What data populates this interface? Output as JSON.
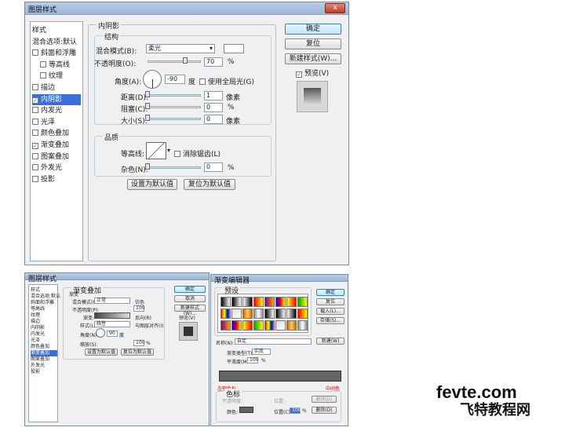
{
  "top": {
    "title": "图层样式",
    "close": "x",
    "sidebar": {
      "items": [
        {
          "label": "样式",
          "check": false,
          "kind": "plain"
        },
        {
          "label": "混合选项:默认",
          "check": false,
          "kind": "plain"
        },
        {
          "label": "斜面和浮雕",
          "check": false,
          "kind": "cb"
        },
        {
          "label": "等高线",
          "check": false,
          "kind": "sub"
        },
        {
          "label": "纹理",
          "check": false,
          "kind": "sub"
        },
        {
          "label": "描边",
          "check": false,
          "kind": "cb"
        },
        {
          "label": "内阴影",
          "check": true,
          "kind": "sel"
        },
        {
          "label": "内发光",
          "check": false,
          "kind": "cb"
        },
        {
          "label": "光泽",
          "check": false,
          "kind": "cb"
        },
        {
          "label": "颜色叠加",
          "check": false,
          "kind": "cb"
        },
        {
          "label": "渐变叠加",
          "check": true,
          "kind": "cb"
        },
        {
          "label": "图案叠加",
          "check": false,
          "kind": "cb"
        },
        {
          "label": "外发光",
          "check": false,
          "kind": "cb"
        },
        {
          "label": "投影",
          "check": false,
          "kind": "cb"
        }
      ]
    },
    "section": "内阴影",
    "struct": "结构",
    "blend_label": "混合模式(B):",
    "blend_value": "柔光",
    "opacity_label": "不透明度(O):",
    "opacity_value": "70",
    "pct": "%",
    "angle_label": "角度(A):",
    "angle_value": "-90",
    "degree": "度",
    "global_light": "使用全局光(G)",
    "distance_label": "距离(D):",
    "distance_value": "1",
    "px": "像素",
    "choke_label": "阻塞(C):",
    "choke_value": "0",
    "size_label": "大小(S):",
    "size_value": "0",
    "quality": "品质",
    "contour_label": "等高线:",
    "antialias": "消除锯齿(L)",
    "noise_label": "杂色(N):",
    "noise_value": "0",
    "set_default": "设置为默认值",
    "reset_default": "复位为默认值",
    "ok": "确定",
    "reset": "复位",
    "new_style": "新建样式(W)...",
    "preview": "预览(V)",
    "opacity_fraction": 0.7
  },
  "bottom_left": {
    "title": "图层样式",
    "section": "渐变叠加",
    "sub": "渐变",
    "blend_label": "混合模式(O):",
    "blend_value": "正常",
    "dither": "仿色",
    "opacity_label": "不透明度(P):",
    "opacity_value": "100",
    "gradient_label": "渐变:",
    "reverse": "反向(R)",
    "style_label": "样式(L):",
    "style_value": "线性",
    "align": "与图层对齐(I)",
    "angle_label": "角度(N):",
    "angle_value": "90",
    "degree": "度",
    "scale_label": "缩放(S):",
    "scale_value": "100",
    "pct": "%",
    "set_default": "设置为默认值",
    "reset_default": "复位为默认值",
    "ok": "确定",
    "cancel": "取消",
    "new_style": "新建样式(W)...",
    "preview": "预览(V)",
    "items": [
      "样式",
      "混合选项:默认",
      "斜面和浮雕",
      "等高线",
      "纹理",
      "描边",
      "内阴影",
      "内发光",
      "光泽",
      "颜色叠加",
      "渐变叠加",
      "图案叠加",
      "外发光",
      "投影"
    ]
  },
  "gradient_editor": {
    "title": "渐变编辑器",
    "presets": "预设",
    "ok": "确定",
    "reset": "复位",
    "load": "载入(L)...",
    "save": "存储(S)...",
    "name_label": "名称(N):",
    "name_value": "自定",
    "new": "新建(W)",
    "type_label": "渐变类型(T):",
    "type_value": "实底",
    "smooth_label": "平滑度(M):",
    "smooth_value": "100",
    "pct": "%",
    "left_color": "#646464",
    "right_color": "#646464",
    "stops": "色标",
    "opacity_label": "不透明度:",
    "location_label": "位置:",
    "delete": "删除(D)",
    "color_label": "颜色:",
    "color_location_label": "位置(C):",
    "color_location_value": "100",
    "red_annotation": "中间色",
    "left_annotation": "左侧色标"
  },
  "watermark": {
    "line1": "fevte.com",
    "line2": "飞特教程网"
  }
}
